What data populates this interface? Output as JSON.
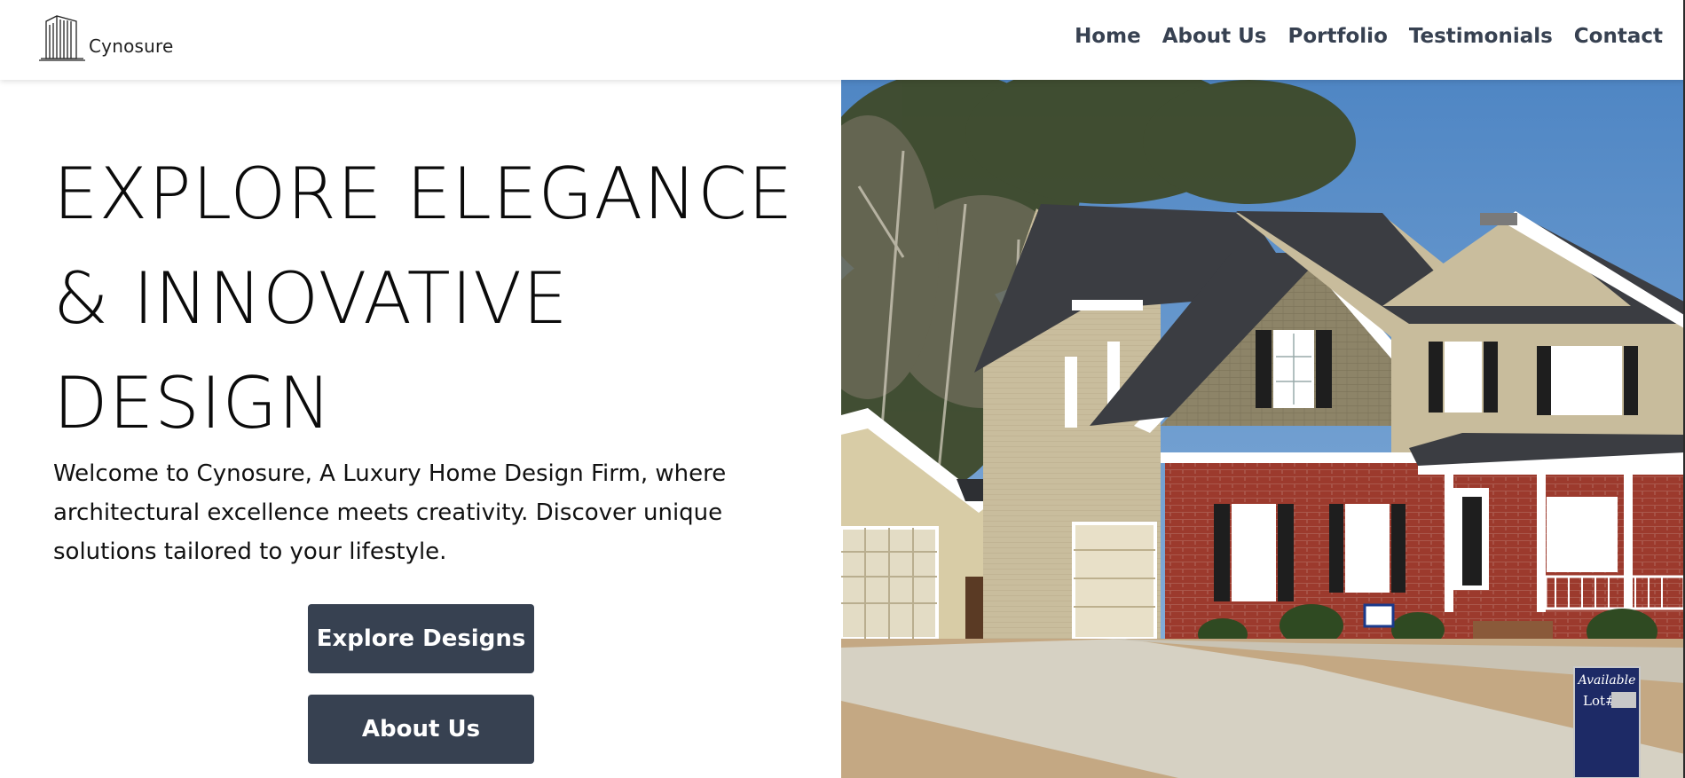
{
  "brand": {
    "name": "Cynosure"
  },
  "nav": {
    "items": [
      {
        "label": "Home"
      },
      {
        "label": "About Us"
      },
      {
        "label": "Portfolio"
      },
      {
        "label": "Testimonials"
      },
      {
        "label": "Contact"
      }
    ]
  },
  "hero": {
    "title_lines": [
      "EXPLORE ELEGANCE",
      "& INNOVATIVE",
      "DESIGN"
    ],
    "description": "Welcome to Cynosure, A Luxury Home Design Firm, where architectural excellence meets creativity. Discover unique solutions tailored to your lifestyle.",
    "buttons": {
      "explore_label": "Explore Designs",
      "about_label": "About Us"
    },
    "image": {
      "subject": "two-story suburban house with red brick and beige siding",
      "sign": {
        "line1": "Available",
        "line2": "Lot#"
      }
    }
  },
  "colors": {
    "button_bg": "#374151",
    "nav_text": "#374151",
    "background": "#ffffff"
  }
}
